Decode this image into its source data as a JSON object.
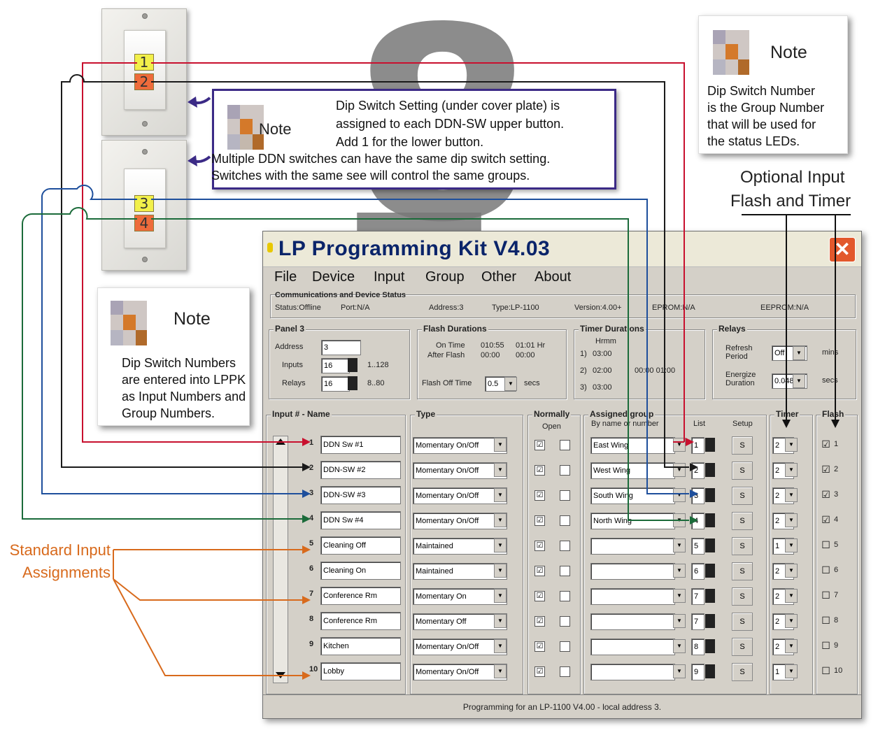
{
  "switches": [
    {
      "upper": "1",
      "lower": "2"
    },
    {
      "upper": "3",
      "lower": "4"
    }
  ],
  "note_top": {
    "title": "Note",
    "line1": "Dip Switch Setting (under cover plate) is",
    "line2": "assigned to each DDN-SW upper button.",
    "line3": "Add 1 for the lower button.",
    "line4": "Multiple DDN switches can have the same dip switch setting.",
    "line5": "Switches with the same see will control the same groups."
  },
  "note_right": {
    "title": "Note",
    "lines": [
      "Dip Switch Number",
      "is the Group Number",
      "that will be used for",
      "the status LEDs."
    ]
  },
  "note_left": {
    "title": "Note",
    "lines": [
      "Dip Switch Numbers",
      "are entered into LPPK",
      "as Input Numbers and",
      "Group Numbers."
    ]
  },
  "optional_label": [
    "Optional Input",
    "Flash and Timer"
  ],
  "standard_label": [
    "Standard Input",
    "Assignments"
  ],
  "window": {
    "title": "LP Programming Kit V4.03",
    "menu": [
      "File",
      "Device",
      "Input",
      "Group",
      "Other",
      "About"
    ],
    "comm_label": "Communications and Device Status",
    "status": "Status:Offline",
    "port": "Port:N/A",
    "address": "Address:3",
    "type": "Type:LP-1100",
    "version": "Version:4.00+",
    "eprom": "EPROM:N/A",
    "eeprom": "EEPROM:N/A",
    "panel": {
      "label": "Panel 3",
      "address_label": "Address",
      "address_value": "3",
      "inputs_label": "Inputs",
      "inputs_value": "16",
      "inputs_range": "1..128",
      "relays_label": "Relays",
      "relays_value": "16",
      "relays_range": "8..80"
    },
    "flash": {
      "label": "Flash Durations",
      "on_label": "On Time",
      "on_value": "010:55",
      "on_value2": "01:01 Hr",
      "after_label": "After Flash",
      "after_value": "00:00",
      "after_value2": "00:00",
      "off_label": "Flash Off Time",
      "off_value": "0.5",
      "off_unit": "secs"
    },
    "timer": {
      "label": "Timer Durations",
      "header": "Hrmm",
      "t1_label": "1)",
      "t1_value": "03:00",
      "t2_label": "2)",
      "t2_value": "02:00",
      "t2_extra": "00:00 01:00",
      "t3_label": "3)",
      "t3_value": "03:00"
    },
    "relays": {
      "label": "Relays",
      "refresh_label": "Refresh Period",
      "refresh_value": "Off",
      "refresh_unit": "mins",
      "energize_label": "Energize Duration",
      "energize_value": "0.048",
      "energize_unit": "secs"
    },
    "columns": {
      "input": "Input # - Name",
      "type": "Type",
      "normally": "Normally",
      "open": "Open",
      "assigned": "Assigned group",
      "byname": "By name or number",
      "list": "List",
      "setup": "Setup",
      "timer": "Timer",
      "flash": "Flash"
    },
    "rows": [
      {
        "num": "1",
        "name": "DDN Sw #1",
        "type": "Momentary On/Off",
        "group": "East Wing",
        "gnum": "1",
        "timer": "2",
        "flash": "1",
        "flash_checked": "☑"
      },
      {
        "num": "2",
        "name": "DDN-SW #2",
        "type": "Momentary On/Off",
        "group": "West Wing",
        "gnum": "2",
        "timer": "2",
        "flash": "2",
        "flash_checked": "☑"
      },
      {
        "num": "3",
        "name": "DDN-SW #3",
        "type": "Momentary On/Off",
        "group": "South Wing",
        "gnum": "3",
        "timer": "2",
        "flash": "3",
        "flash_checked": "☑"
      },
      {
        "num": "4",
        "name": "DDN Sw #4",
        "type": "Momentary On/Off",
        "group": "North Wing",
        "gnum": "4",
        "timer": "2",
        "flash": "4",
        "flash_checked": "☑"
      },
      {
        "num": "5",
        "name": "Cleaning Off",
        "type": "Maintained",
        "group": "",
        "gnum": "5",
        "timer": "1",
        "flash": "5",
        "flash_checked": "☐"
      },
      {
        "num": "6",
        "name": "Cleaning On",
        "type": "Maintained",
        "group": "",
        "gnum": "6",
        "timer": "2",
        "flash": "6",
        "flash_checked": "☐"
      },
      {
        "num": "7",
        "name": "Conference Rm",
        "type": "Momentary On",
        "group": "",
        "gnum": "7",
        "timer": "2",
        "flash": "7",
        "flash_checked": "☐"
      },
      {
        "num": "8",
        "name": "Conference Rm",
        "type": "Momentary Off",
        "group": "",
        "gnum": "7",
        "timer": "2",
        "flash": "8",
        "flash_checked": "☐"
      },
      {
        "num": "9",
        "name": "Kitchen",
        "type": "Momentary On/Off",
        "group": "",
        "gnum": "8",
        "timer": "2",
        "flash": "9",
        "flash_checked": "☐"
      },
      {
        "num": "10",
        "name": "Lobby",
        "type": "Momentary On/Off",
        "group": "",
        "gnum": "9",
        "timer": "1",
        "flash": "10",
        "flash_checked": "☐"
      }
    ],
    "status_bar": "Programming for an LP-1100 V4.00 - local address 3."
  },
  "colors": {
    "red": "#c8102e",
    "black": "#1a1a1a",
    "blue": "#1e4f9c",
    "green": "#1b6b3a",
    "orange": "#d86a1c",
    "purple": "#3b2a86"
  }
}
